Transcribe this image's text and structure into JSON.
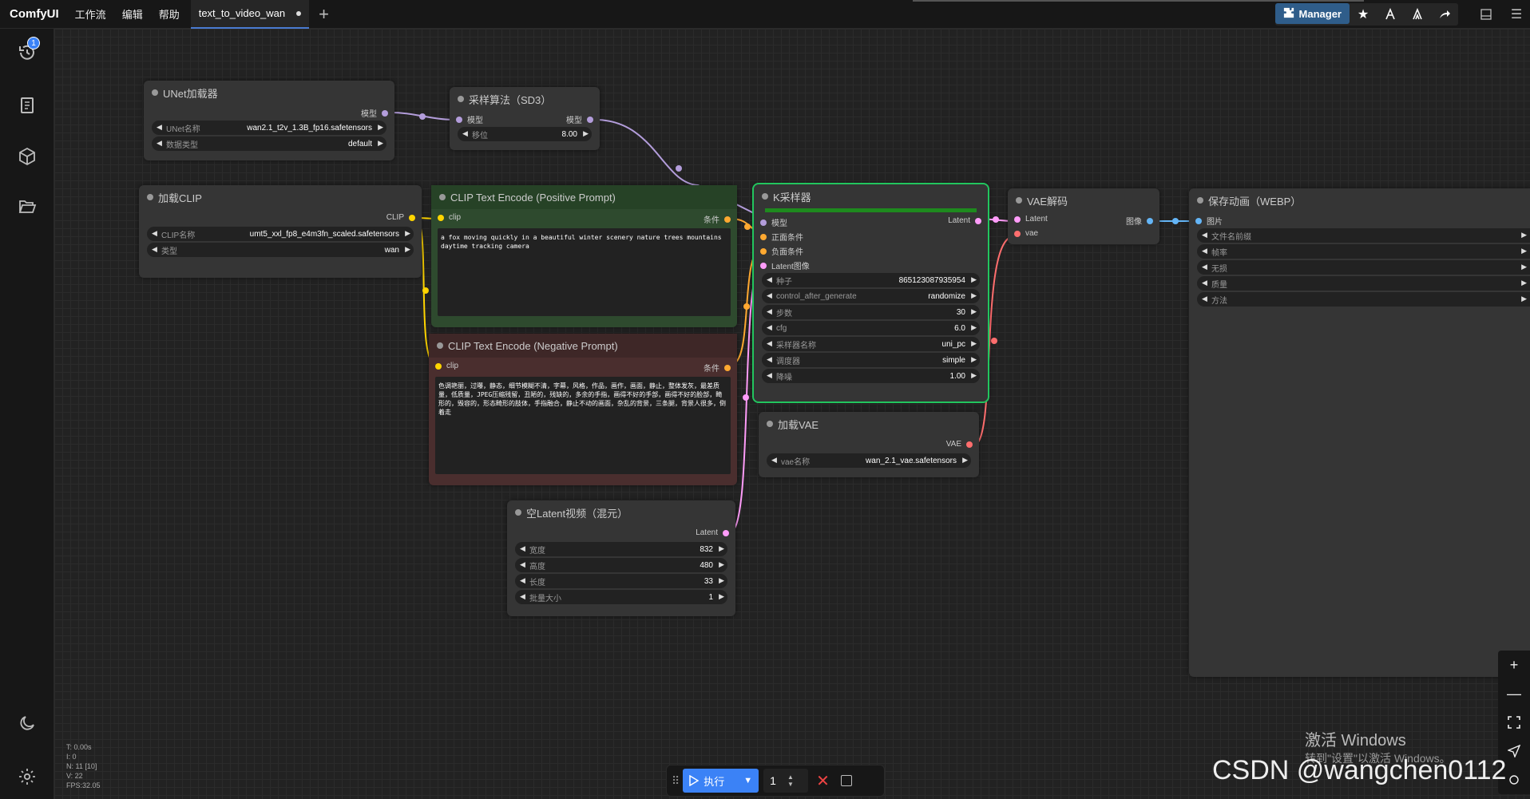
{
  "app": {
    "logo": "ComfyUI"
  },
  "menu": [
    "工作流",
    "编辑",
    "帮助"
  ],
  "tab": {
    "label": "text_to_video_wan"
  },
  "toolbar": {
    "manager_label": "Manager"
  },
  "sidebar": {
    "badge": "1"
  },
  "nodes": {
    "unet": {
      "title": "UNet加载器",
      "output": "模型",
      "widgets": [
        {
          "label": "UNet名称",
          "value": "wan2.1_t2v_1.3B_fp16.safetensors"
        },
        {
          "label": "数据类型",
          "value": "default"
        }
      ]
    },
    "sd3": {
      "title": "采样算法（SD3）",
      "input": "模型",
      "output": "模型",
      "widgets": [
        {
          "label": "移位",
          "value": "8.00"
        }
      ]
    },
    "clip": {
      "title": "加载CLIP",
      "output": "CLIP",
      "widgets": [
        {
          "label": "CLIP名称",
          "value": "umt5_xxl_fp8_e4m3fn_scaled.safetensors"
        },
        {
          "label": "类型",
          "value": "wan"
        }
      ]
    },
    "pos": {
      "title": "CLIP Text Encode (Positive Prompt)",
      "input": "clip",
      "output": "条件",
      "text": "a fox moving quickly in a beautiful winter scenery nature trees mountains daytime tracking camera"
    },
    "neg": {
      "title": "CLIP Text Encode (Negative Prompt)",
      "input": "clip",
      "output": "条件",
      "text": "色调艳丽，过曝，静态，细节模糊不清，字幕，风格，作品，画作，画面，静止，整体发灰，最差质量，低质量，JPEG压缩残留，丑陋的，残缺的，多余的手指，画得不好的手部，画得不好的脸部，畸形的，毁容的，形态畸形的肢体，手指融合，静止不动的画面，杂乱的背景，三条腿，背景人很多，倒着走"
    },
    "latent": {
      "title": "空Latent视频（混元）",
      "output": "Latent",
      "widgets": [
        {
          "label": "宽度",
          "value": "832"
        },
        {
          "label": "高度",
          "value": "480"
        },
        {
          "label": "长度",
          "value": "33"
        },
        {
          "label": "批量大小",
          "value": "1"
        }
      ]
    },
    "ksampler": {
      "title": "K采样器",
      "inputs": [
        "模型",
        "正面条件",
        "负面条件",
        "Latent图像"
      ],
      "output": "Latent",
      "widgets": [
        {
          "label": "种子",
          "value": "865123087935954"
        },
        {
          "label": "control_after_generate",
          "value": "randomize"
        },
        {
          "label": "步数",
          "value": "30"
        },
        {
          "label": "cfg",
          "value": "6.0"
        },
        {
          "label": "采样器名称",
          "value": "uni_pc"
        },
        {
          "label": "调度器",
          "value": "simple"
        },
        {
          "label": "降噪",
          "value": "1.00"
        }
      ]
    },
    "vaeload": {
      "title": "加载VAE",
      "output": "VAE",
      "widgets": [
        {
          "label": "vae名称",
          "value": "wan_2.1_vae.safetensors"
        }
      ]
    },
    "vaedecode": {
      "title": "VAE解码",
      "inputs": [
        "Latent",
        "vae"
      ],
      "output": "图像"
    },
    "save": {
      "title": "保存动画（WEBP）",
      "input": "图片",
      "widgets": [
        {
          "label": "文件名前缀",
          "value": ""
        },
        {
          "label": "帧率",
          "value": ""
        },
        {
          "label": "无损",
          "value": ""
        },
        {
          "label": "质量",
          "value": ""
        },
        {
          "label": "方法",
          "value": ""
        }
      ]
    }
  },
  "runbar": {
    "run_label": "执行",
    "count": "1"
  },
  "stats": [
    "T: 0.00s",
    "I: 0",
    "N: 11 [10]",
    "V: 22",
    "FPS:32.05"
  ],
  "watermark": {
    "line1": "激活 Windows",
    "line2": "转到\"设置\"以激活 Windows。",
    "csdn": "CSDN @wangchen0112"
  },
  "colors": {
    "accent": "#3b82f6",
    "selected": "#22c55e",
    "model": "#b39ddb",
    "clip": "#ffd500",
    "cond": "#ffa931",
    "latent": "#ff9cf9",
    "vae": "#ff6e6e",
    "image": "#64b5f6"
  }
}
